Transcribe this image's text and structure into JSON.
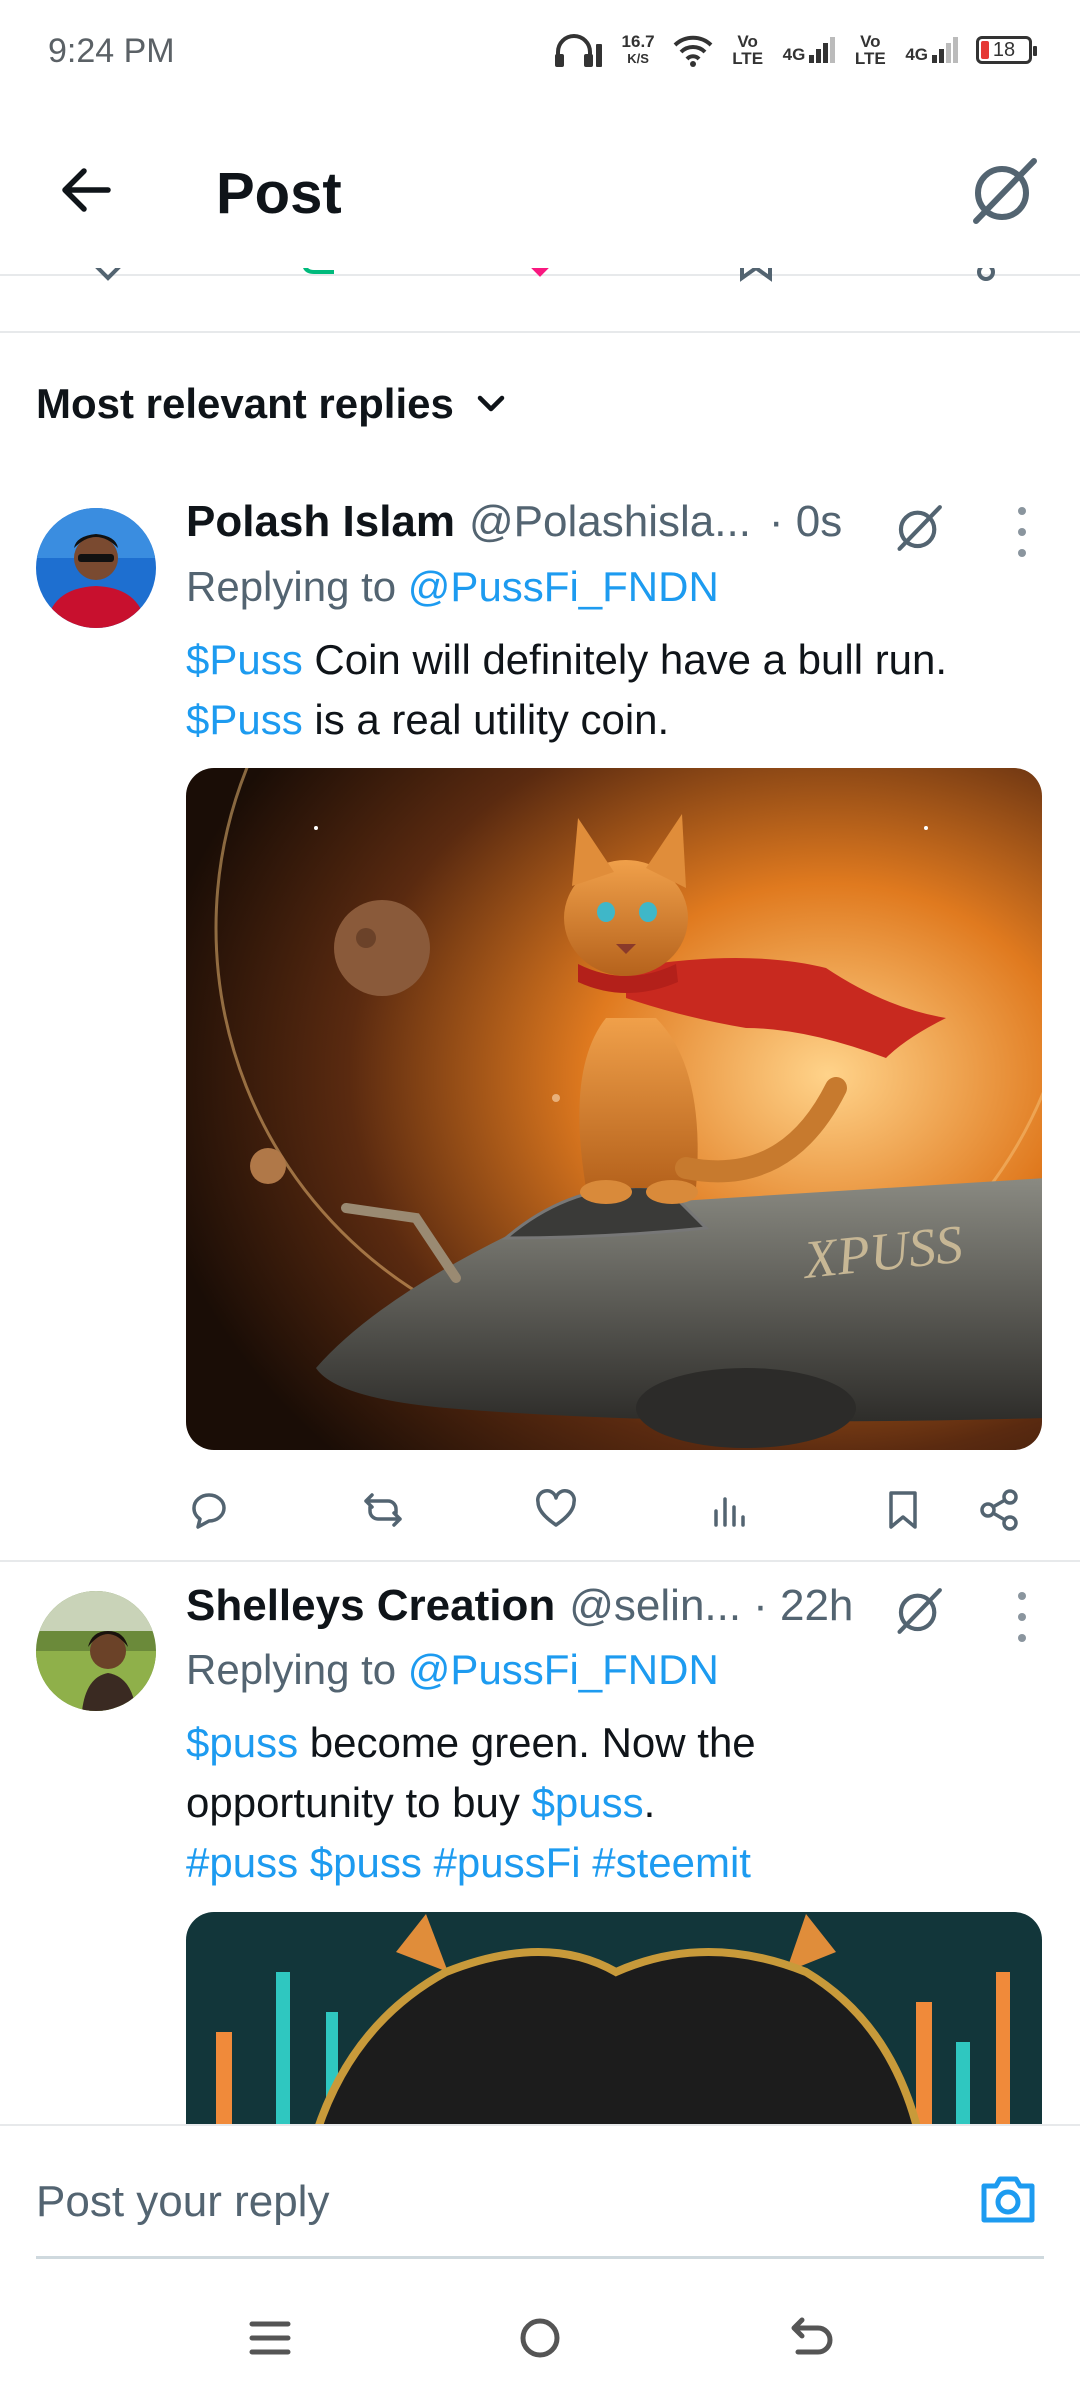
{
  "status_bar": {
    "time": "9:24 PM",
    "speed_value": "16.7",
    "speed_unit": "K/S",
    "sim1_label": "Vo LTE",
    "sim1_net": "4G",
    "sim2_label": "Vo LTE",
    "sim2_net": "4G",
    "battery": "18"
  },
  "header": {
    "title": "Post",
    "back_icon": "arrow-left-icon",
    "logo_icon": "grok-slash-icon"
  },
  "sort": {
    "label": "Most relevant replies"
  },
  "replies": [
    {
      "name": "Polash Islam",
      "handle": "@Polashisla...",
      "time": "· 0s",
      "replying_prefix": "Replying to ",
      "replying_to": "@PussFi_FNDN",
      "line1_tag": "$Puss",
      "line1_rest": " Coin will definitely have a bull run.",
      "line2_tag": "$Puss",
      "line2_rest": " is a real utility coin.",
      "image_text": "PUSS"
    },
    {
      "name": "Shelleys Creation",
      "handle": "@selin...",
      "time": "· 22h",
      "replying_prefix": "Replying to ",
      "replying_to": "@PussFi_FNDN",
      "line1_tag": "$puss",
      "line1_rest": " become green. Now the",
      "line2_start": "opportunity to buy ",
      "line2_tag": "$puss",
      "line2_end": ".",
      "hashtags": "#puss $puss #pussFi #steemit"
    }
  ],
  "composer": {
    "placeholder": "Post your reply"
  },
  "colors": {
    "link": "#1d9bf0",
    "text": "#0f1419",
    "muted": "#536471"
  }
}
